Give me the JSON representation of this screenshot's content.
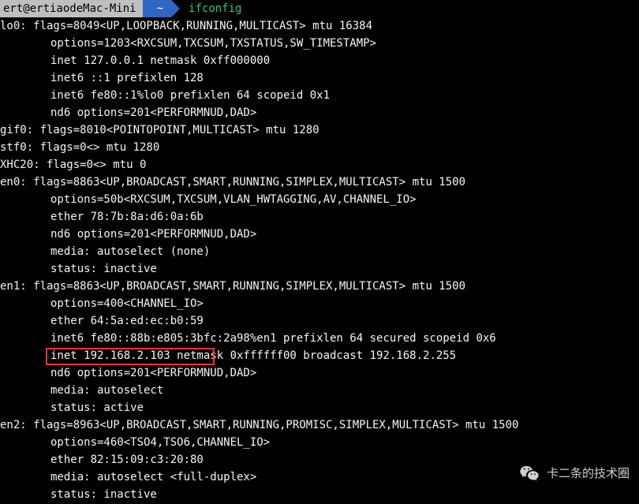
{
  "prompt": {
    "user_host": "ert@ertiaodeMac-Mini",
    "dir": "~",
    "command": "ifconfig"
  },
  "lines": {
    "l0": "lo0: flags=8049<UP,LOOPBACK,RUNNING,MULTICAST> mtu 16384",
    "l1": "options=1203<RXCSUM,TXCSUM,TXSTATUS,SW_TIMESTAMP>",
    "l2": "inet 127.0.0.1 netmask 0xff000000",
    "l3": "inet6 ::1 prefixlen 128",
    "l4": "inet6 fe80::1%lo0 prefixlen 64 scopeid 0x1",
    "l5": "nd6 options=201<PERFORMNUD,DAD>",
    "l6": "gif0: flags=8010<POINTOPOINT,MULTICAST> mtu 1280",
    "l7": "stf0: flags=0<> mtu 1280",
    "l8": "XHC20: flags=0<> mtu 0",
    "l9": "en0: flags=8863<UP,BROADCAST,SMART,RUNNING,SIMPLEX,MULTICAST> mtu 1500",
    "l10": "options=50b<RXCSUM,TXCSUM,VLAN_HWTAGGING,AV,CHANNEL_IO>",
    "l11": "ether 78:7b:8a:d6:0a:6b",
    "l12": "nd6 options=201<PERFORMNUD,DAD>",
    "l13": "media: autoselect (none)",
    "l14": "status: inactive",
    "l15": "en1: flags=8863<UP,BROADCAST,SMART,RUNNING,SIMPLEX,MULTICAST> mtu 1500",
    "l16": "options=400<CHANNEL_IO>",
    "l17": "ether 64:5a:ed:ec:b0:59",
    "l18": "inet6 fe80::88b:e805:3bfc:2a98%en1 prefixlen 64 secured scopeid 0x6",
    "l19": "inet 192.168.2.103 netmask 0xffffff00 broadcast 192.168.2.255",
    "l20": "nd6 options=201<PERFORMNUD,DAD>",
    "l21": "media: autoselect",
    "l22": "status: active",
    "l23": "en2: flags=8963<UP,BROADCAST,SMART,RUNNING,PROMISC,SIMPLEX,MULTICAST> mtu 1500",
    "l24": "options=460<TSO4,TSO6,CHANNEL_IO>",
    "l25": "ether 82:15:09:c3:20:80",
    "l26": "media: autoselect <full-duplex>",
    "l27": "status: inactive"
  },
  "watermark": {
    "text": "卡二条的技术圈"
  }
}
